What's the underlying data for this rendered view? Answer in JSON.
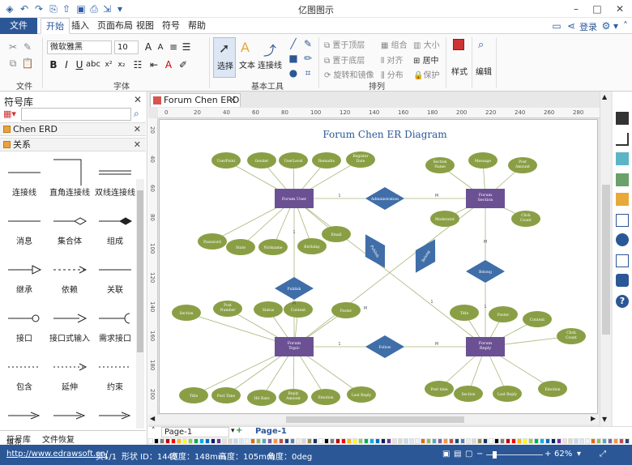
{
  "app": {
    "title": "亿图图示",
    "login": "登录"
  },
  "menu": {
    "file": "文件",
    "items": [
      "开始",
      "插入",
      "页面布局",
      "视图",
      "符号",
      "帮助"
    ]
  },
  "ribbon": {
    "font_name": "微软雅黑",
    "font_size": "10",
    "groups": {
      "file": "文件",
      "font": "字体",
      "basic_tools": "基本工具",
      "arrange": "排列"
    },
    "tools": {
      "select": "选择",
      "text": "文本",
      "connector": "连接线"
    },
    "arrange_items": {
      "to_top": "置于顶层",
      "to_bottom": "置于底层",
      "rotate_mirror": "旋转和镜像",
      "group": "组合",
      "align": "对齐",
      "distribute": "分布",
      "size": "大小",
      "center": "居中",
      "protect": "保护"
    },
    "style": "样式",
    "edit": "编辑"
  },
  "sidebar": {
    "title": "符号库",
    "categories": [
      "Chen ERD",
      "关系"
    ],
    "shapes": [
      "连接线",
      "直角连接线",
      "双线连接线",
      "消息",
      "集合体",
      "组成",
      "继承",
      "依赖",
      "关联",
      "接口",
      "接口式输入",
      "需求接口",
      "包含",
      "延伸",
      "约束"
    ],
    "tabs": [
      "符号库",
      "文件恢复"
    ]
  },
  "document": {
    "tab_name": "Forum Chen ERD",
    "page_name": "Page-1",
    "page_name_active": "Page-1"
  },
  "diagram": {
    "title": "Forum Chen ER Diagram",
    "entities": [
      "Forum User",
      "Forum Section",
      "Forum Topic",
      "Forum Reply"
    ],
    "relationships": [
      "Administration",
      "Publish",
      "Belong",
      "Follow",
      "Publish",
      "Belong"
    ],
    "attributes": {
      "user": [
        "UserPoint",
        "Gender",
        "UserLevel",
        "Remarks",
        "Register Date",
        "Password",
        "State",
        "Nickname",
        "Birthday",
        "Email"
      ],
      "section": [
        "Section Name",
        "Message",
        "Post Amount",
        "Moderator",
        "Click Count"
      ],
      "topic": [
        "Section",
        "Post Number",
        "Status",
        "Content",
        "Poster",
        "Title",
        "Post Time",
        "Hit Rate",
        "Reply Amount",
        "Emotion",
        "Last Reply"
      ],
      "reply": [
        "Title",
        "Poster",
        "Content",
        "Click Count",
        "Post time",
        "Section",
        "Last Reply",
        "Emotion"
      ]
    },
    "cardinality": [
      "1",
      "M",
      "1",
      "M",
      "1",
      "M",
      "M",
      "1",
      "M",
      "1"
    ]
  },
  "ruler": {
    "h": [
      "0",
      "20",
      "40",
      "60",
      "80",
      "100",
      "120",
      "140",
      "160",
      "180",
      "200",
      "220",
      "240",
      "260",
      "280"
    ],
    "v": [
      "20",
      "40",
      "60",
      "80",
      "100",
      "120",
      "140",
      "160",
      "180",
      "200"
    ]
  },
  "pagebar": {
    "fill": "填充"
  },
  "status": {
    "url": "http://www.edrawsoft.cn/",
    "page": "页1/1",
    "shape_id": "形状 ID：1449",
    "width": "宽度：148mm",
    "height": "高度：105mm",
    "angle": "角度：0deg",
    "zoom": "62%"
  },
  "colors": {
    "brand": "#2b5797",
    "entity": "#6b5193",
    "relationship": "#3f6ea8",
    "attribute": "#8a9f45",
    "line": "#a7b77a"
  }
}
